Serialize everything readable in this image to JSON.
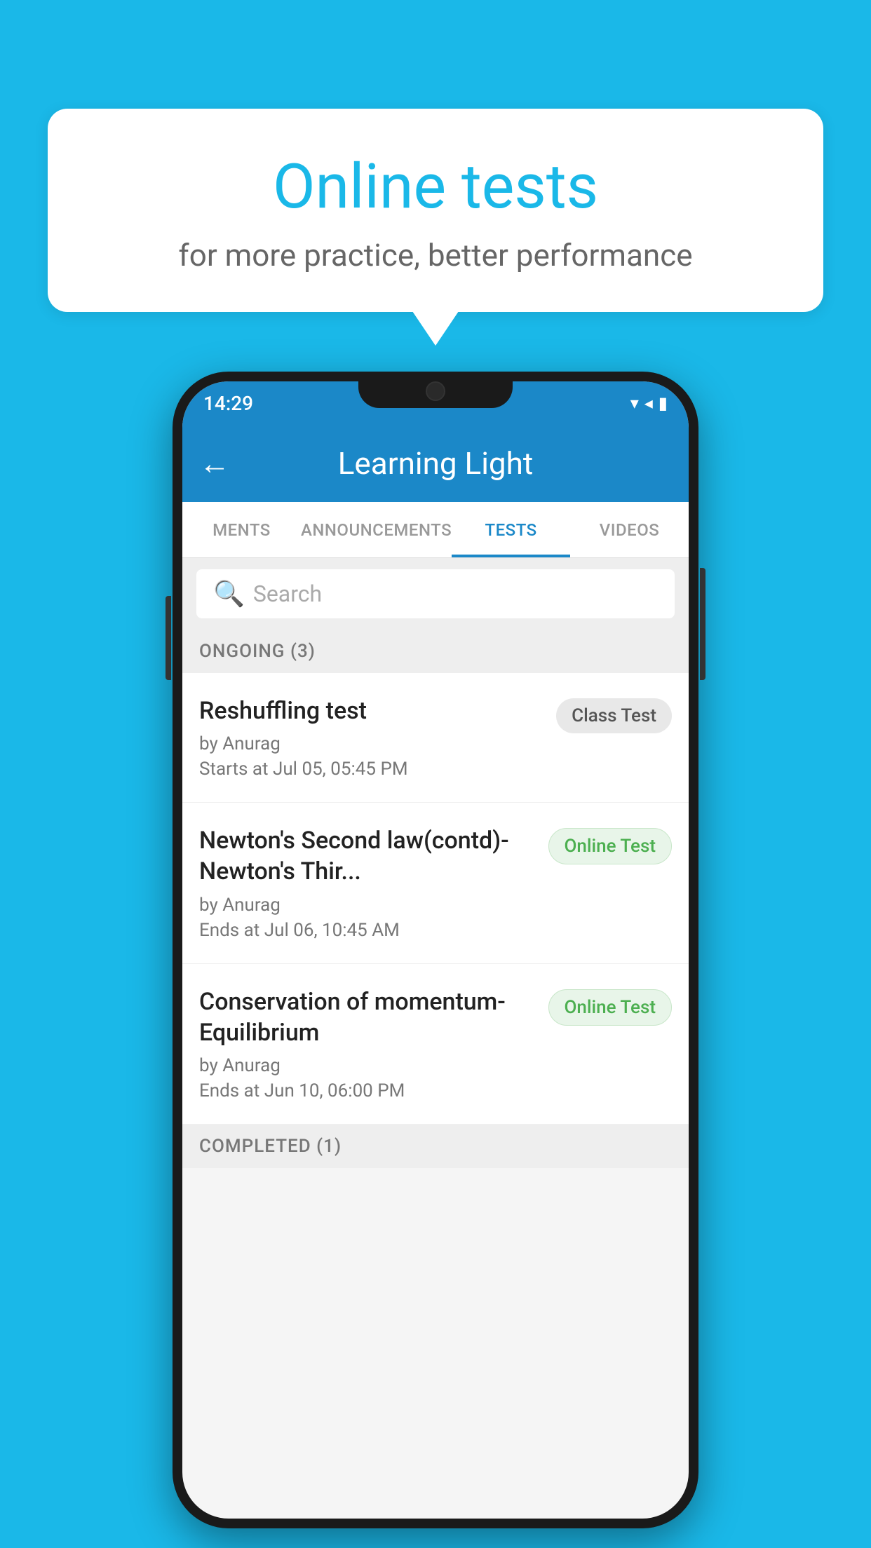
{
  "background_color": "#1ab8e8",
  "speech_bubble": {
    "title": "Online tests",
    "subtitle": "for more practice, better performance"
  },
  "phone": {
    "status_bar": {
      "time": "14:29",
      "icons": [
        "wifi",
        "signal",
        "battery"
      ]
    },
    "app_bar": {
      "title": "Learning Light",
      "back_label": "←"
    },
    "tabs": [
      {
        "label": "MENTS",
        "active": false
      },
      {
        "label": "ANNOUNCEMENTS",
        "active": false
      },
      {
        "label": "TESTS",
        "active": true
      },
      {
        "label": "VIDEOS",
        "active": false
      }
    ],
    "search": {
      "placeholder": "Search"
    },
    "sections": [
      {
        "header": "ONGOING (3)",
        "tests": [
          {
            "name": "Reshuffling test",
            "author": "by Anurag",
            "time": "Starts at  Jul 05, 05:45 PM",
            "badge": "Class Test",
            "badge_type": "class"
          },
          {
            "name": "Newton's Second law(contd)-Newton's Thir...",
            "author": "by Anurag",
            "time": "Ends at  Jul 06, 10:45 AM",
            "badge": "Online Test",
            "badge_type": "online"
          },
          {
            "name": "Conservation of momentum-Equilibrium",
            "author": "by Anurag",
            "time": "Ends at  Jun 10, 06:00 PM",
            "badge": "Online Test",
            "badge_type": "online"
          }
        ]
      }
    ],
    "completed_header": "COMPLETED (1)"
  }
}
